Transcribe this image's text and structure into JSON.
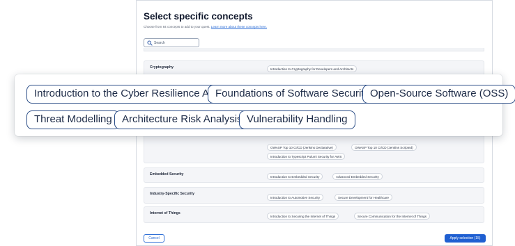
{
  "modal": {
    "title": "Select specific concepts",
    "subtitle": "Choose from 84 concepts to add to your quest.",
    "learn_more_link": "Learn more about these concepts here.",
    "search_placeholder": "Search"
  },
  "rows": [
    {
      "name": "Cryptography",
      "chips": [
        "Introduction to Cryptography for Developers and Architects"
      ]
    },
    {
      "name": "",
      "chips": [
        "OWASP Top 10 CI/CD (Jenkins Declarative)",
        "OWASP Top 10 CI/CD (Jenkins Scripted)",
        "Introduction to Typescript Pulumi Security for AWS"
      ]
    },
    {
      "name": "Embedded Security",
      "chips": [
        "Introduction to Embedded Security",
        "Advanced Embedded Security"
      ]
    },
    {
      "name": "Industry-Specific Security",
      "chips": [
        "Introduction to Automotive Security",
        "Secure Development for Healthcare"
      ]
    },
    {
      "name": "Internet of Things",
      "chips": [
        "Introduction to Securing the Internet of Things",
        "Secure Communication for the Internet of Things"
      ]
    }
  ],
  "popover": {
    "chips": [
      "Introduction to the Cyber Resilience Act",
      "Foundations of Software Security",
      "Open-Source Software (OSS)",
      "Threat Modelling",
      "Architecture Risk Analysis",
      "Vulnerability Handling"
    ]
  },
  "footer": {
    "cancel_label": "Cancel",
    "apply_label": "Apply selection (15)"
  },
  "colors": {
    "accent": "#1f5fd1",
    "chip_border": "#2a4c86",
    "row_bg": "#f4f5f8"
  },
  "icons": {
    "search": "search-icon"
  }
}
